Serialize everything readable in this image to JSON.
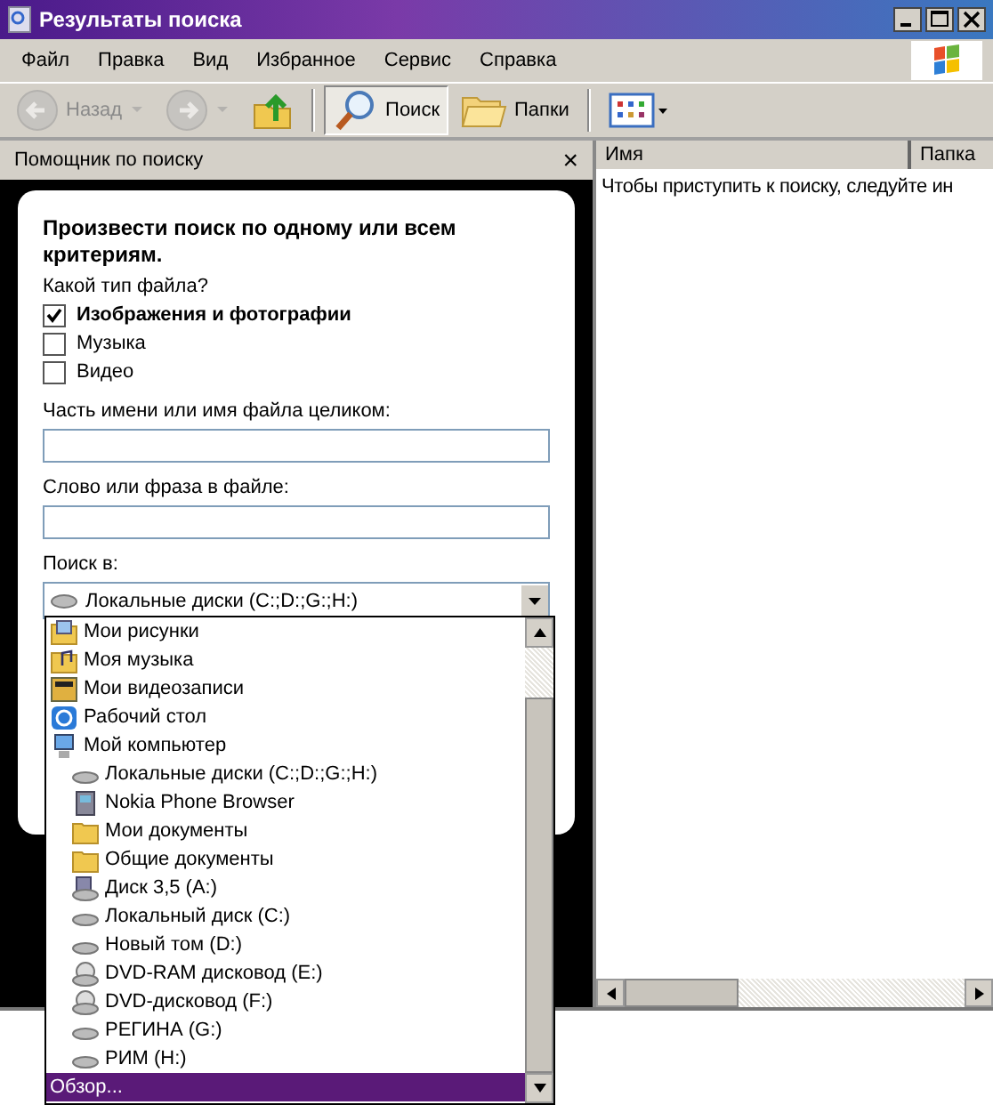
{
  "window": {
    "title": "Результаты поиска"
  },
  "menu": [
    "Файл",
    "Правка",
    "Вид",
    "Избранное",
    "Сервис",
    "Справка"
  ],
  "toolbar": [
    {
      "kind": "back",
      "label": "Назад",
      "disabled": true,
      "selected": false
    },
    {
      "kind": "forward",
      "disabled": true,
      "selected": false
    },
    {
      "kind": "up",
      "disabled": false,
      "selected": false
    },
    {
      "kind": "search",
      "label": "Поиск",
      "disabled": false,
      "selected": true
    },
    {
      "kind": "folders",
      "label": "Папки",
      "disabled": false,
      "selected": false
    },
    {
      "kind": "views",
      "disabled": false,
      "selected": false
    }
  ],
  "search_panel": {
    "title": "Помощник по поиску",
    "close": "×",
    "heading": "Произвести поиск по одному или всем критериям.",
    "question": "Какой тип файла?",
    "file_types": [
      {
        "label": "Изображения и фотографии",
        "checked": true
      },
      {
        "label": "Музыка",
        "checked": false
      },
      {
        "label": "Видео",
        "checked": false
      }
    ],
    "name_field": {
      "label": "Часть имени или имя файла целиком:"
    },
    "phrase_field": {
      "label": "Слово или фраза в файле:"
    },
    "look_in": {
      "label": "Поиск в:",
      "value": "Локальные диски (C:;D:;G:;H:)",
      "dropdown": {
        "items": [
          {
            "kind": "pictures",
            "label": "Мои рисунки",
            "selected": false
          },
          {
            "kind": "music",
            "label": "Моя музыка",
            "selected": false
          },
          {
            "kind": "video",
            "label": "Мои видеозаписи",
            "selected": false
          },
          {
            "kind": "desktop",
            "label": "Рабочий стол",
            "selected": false
          },
          {
            "kind": "computer",
            "label": "Мой компьютер",
            "selected": false,
            "children": [
              {
                "kind": "drive",
                "label": "Локальные диски (C:;D:;G:;H:)",
                "selected": false
              },
              {
                "kind": "phone",
                "label": "Nokia Phone Browser",
                "selected": false
              },
              {
                "kind": "folder",
                "label": "Мои документы",
                "selected": false
              },
              {
                "kind": "folder",
                "label": "Общие документы",
                "selected": false
              },
              {
                "kind": "floppy",
                "label": "Диск 3,5 (A:)",
                "selected": false
              },
              {
                "kind": "drive",
                "label": "Локальный диск (C:)",
                "selected": false
              },
              {
                "kind": "drive",
                "label": "Новый том (D:)",
                "selected": false
              },
              {
                "kind": "dvd",
                "label": "DVD-RAM дисковод (E:)",
                "selected": false
              },
              {
                "kind": "dvd",
                "label": "DVD-дисковод (F:)",
                "selected": false
              },
              {
                "kind": "drive",
                "label": "РЕГИНА (G:)",
                "selected": false
              },
              {
                "kind": "drive",
                "label": "РИМ (H:)",
                "selected": false
              }
            ]
          },
          {
            "kind": "browse",
            "label": "Обзор...",
            "selected": true
          }
        ]
      }
    }
  },
  "results": {
    "columns": [
      "Имя",
      "Папка"
    ],
    "message": "Чтобы приступить к поиску, следуйте ин"
  }
}
